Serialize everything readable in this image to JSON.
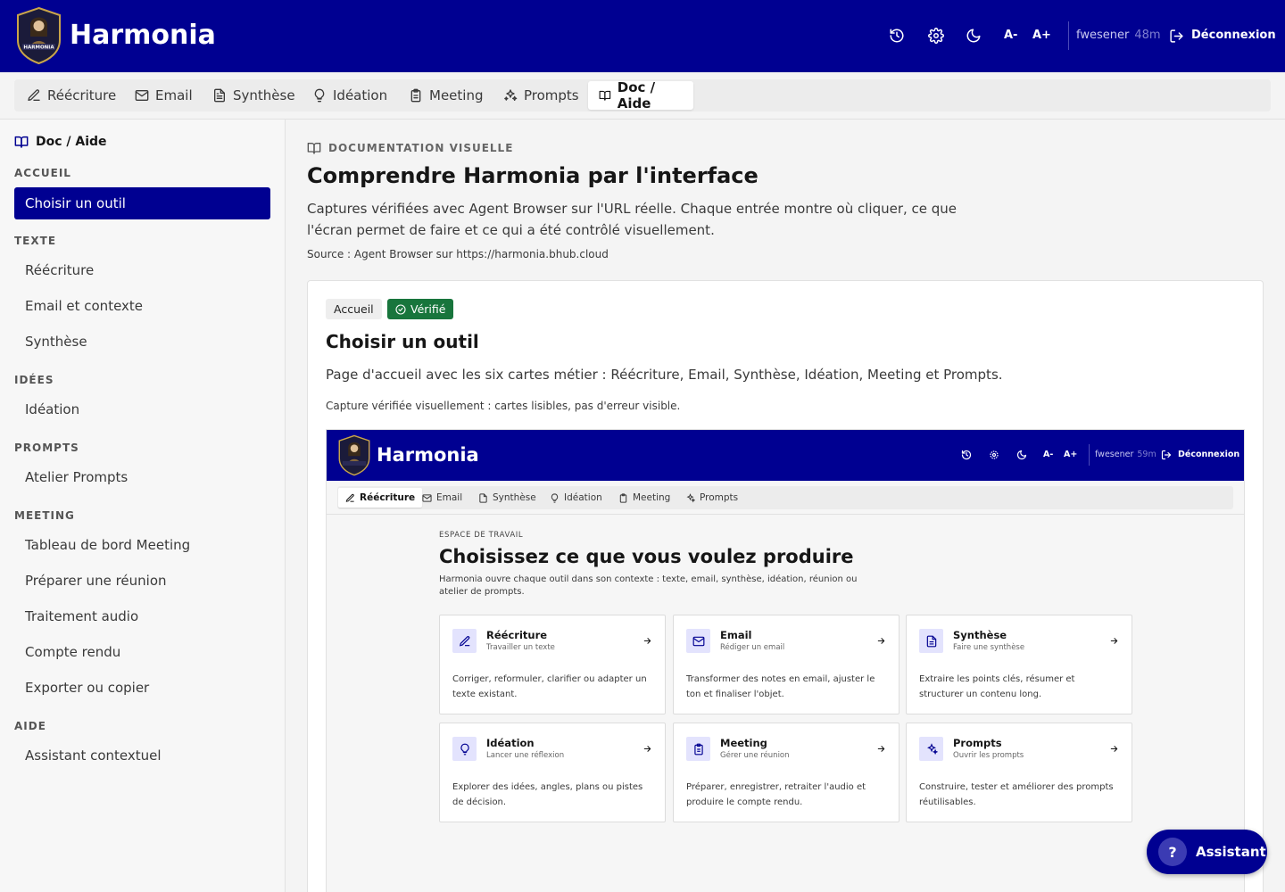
{
  "header": {
    "brand": "Harmonia",
    "font_decrease": "A-",
    "font_increase": "A+",
    "user": "fwesener",
    "session_time": "48m",
    "logout": "Déconnexion",
    "logo_text": "HARMONIA",
    "bg_color": "#000091"
  },
  "tabs": [
    {
      "label": "Réécriture",
      "icon": "pencil-icon",
      "active": false
    },
    {
      "label": "Email",
      "icon": "mail-icon",
      "active": false
    },
    {
      "label": "Synthèse",
      "icon": "document-icon",
      "active": false
    },
    {
      "label": "Idéation",
      "icon": "lightbulb-icon",
      "active": false
    },
    {
      "label": "Meeting",
      "icon": "clipboard-icon",
      "active": false
    },
    {
      "label": "Prompts",
      "icon": "sparkles-icon",
      "active": false
    },
    {
      "label": "Doc / Aide",
      "icon": "book-icon",
      "active": true
    }
  ],
  "sidebar": {
    "title": "Doc / Aide",
    "sections": [
      {
        "label": "ACCUEIL",
        "items": [
          "Choisir un outil"
        ]
      },
      {
        "label": "TEXTE",
        "items": [
          "Réécriture",
          "Email et contexte",
          "Synthèse"
        ]
      },
      {
        "label": "IDÉES",
        "items": [
          "Idéation"
        ]
      },
      {
        "label": "PROMPTS",
        "items": [
          "Atelier Prompts"
        ]
      },
      {
        "label": "MEETING",
        "items": [
          "Tableau de bord Meeting",
          "Préparer une réunion",
          "Traitement audio",
          "Compte rendu",
          "Exporter ou copier"
        ]
      },
      {
        "label": "AIDE",
        "items": [
          "Assistant contextuel"
        ]
      }
    ],
    "active_item": "Choisir un outil"
  },
  "main": {
    "eyebrow": "DOCUMENTATION VISUELLE",
    "title": "Comprendre Harmonia par l'interface",
    "lead": "Captures vérifiées avec Agent Browser sur l'URL réelle. Chaque entrée montre où cliquer, ce que l'écran permet de faire et ce qui a été contrôlé visuellement.",
    "source": "Source : Agent Browser sur https://harmonia.bhub.cloud"
  },
  "entry": {
    "badge_section": "Accueil",
    "badge_status": "Vérifié",
    "title": "Choisir un outil",
    "description": "Page d'accueil avec les six cartes métier : Réécriture, Email, Synthèse, Idéation, Meeting et Prompts.",
    "note": "Capture vérifiée visuellement : cartes lisibles, pas d'erreur visible."
  },
  "screenshot": {
    "brand": "Harmonia",
    "user": "fwesener",
    "session_time": "59m",
    "logout": "Déconnexion",
    "font_decrease": "A-",
    "font_increase": "A+",
    "tabs": [
      "Réécriture",
      "Email",
      "Synthèse",
      "Idéation",
      "Meeting",
      "Prompts"
    ],
    "eyebrow": "ESPACE DE TRAVAIL",
    "title": "Choisissez ce que vous voulez produire",
    "lead": "Harmonia ouvre chaque outil dans son contexte : texte, email, synthèse, idéation, réunion ou atelier de prompts.",
    "cards": [
      {
        "title": "Réécriture",
        "subtitle": "Travailler un texte",
        "desc": "Corriger, reformuler, clarifier ou adapter un texte existant.",
        "icon": "pencil-icon"
      },
      {
        "title": "Email",
        "subtitle": "Rédiger un email",
        "desc": "Transformer des notes en email, ajuster le ton et finaliser l'objet.",
        "icon": "mail-icon"
      },
      {
        "title": "Synthèse",
        "subtitle": "Faire une synthèse",
        "desc": "Extraire les points clés, résumer et structurer un contenu long.",
        "icon": "document-icon"
      },
      {
        "title": "Idéation",
        "subtitle": "Lancer une réflexion",
        "desc": "Explorer des idées, angles, plans ou pistes de décision.",
        "icon": "lightbulb-icon"
      },
      {
        "title": "Meeting",
        "subtitle": "Gérer une réunion",
        "desc": "Préparer, enregistrer, retraiter l'audio et produire le compte rendu.",
        "icon": "clipboard-icon"
      },
      {
        "title": "Prompts",
        "subtitle": "Ouvrir les prompts",
        "desc": "Construire, tester et améliorer des prompts réutilisables.",
        "icon": "sparkles-icon"
      }
    ]
  },
  "assistant": {
    "label": "Assistant",
    "icon_char": "?"
  }
}
